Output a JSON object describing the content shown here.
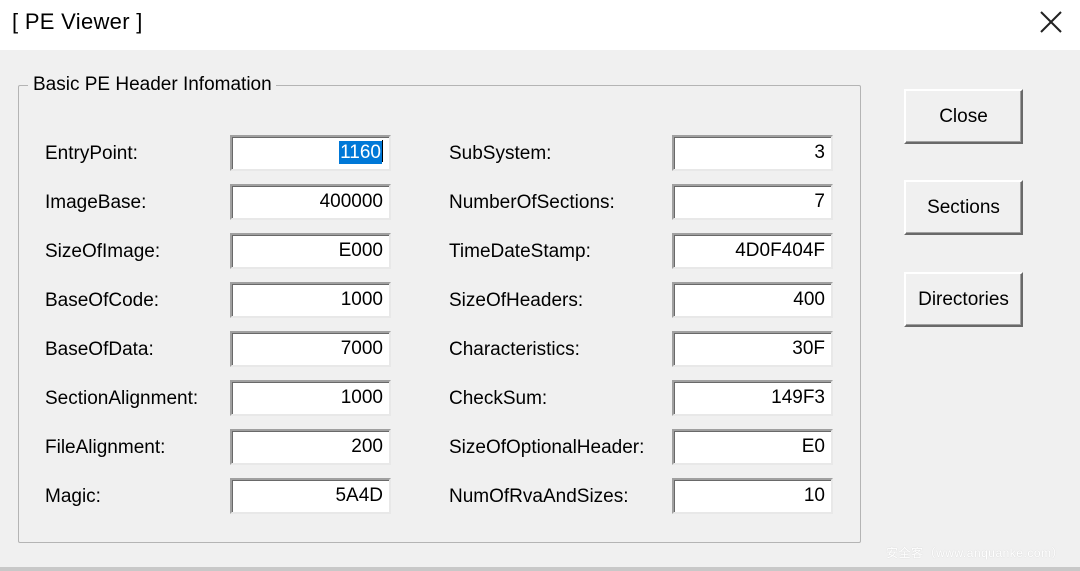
{
  "window": {
    "title": "[ PE Viewer ]",
    "close_icon": "close-icon"
  },
  "group": {
    "legend": "Basic PE Header Infomation"
  },
  "left_fields": [
    {
      "label": "EntryPoint:",
      "value": "1160"
    },
    {
      "label": "ImageBase:",
      "value": "400000"
    },
    {
      "label": "SizeOfImage:",
      "value": "E000"
    },
    {
      "label": "BaseOfCode:",
      "value": "1000"
    },
    {
      "label": "BaseOfData:",
      "value": "7000"
    },
    {
      "label": "SectionAlignment:",
      "value": "1000"
    },
    {
      "label": "FileAlignment:",
      "value": "200"
    },
    {
      "label": "Magic:",
      "value": "5A4D"
    }
  ],
  "right_fields": [
    {
      "label": "SubSystem:",
      "value": "3"
    },
    {
      "label": "NumberOfSections:",
      "value": "7"
    },
    {
      "label": "TimeDateStamp:",
      "value": "4D0F404F"
    },
    {
      "label": "SizeOfHeaders:",
      "value": "400"
    },
    {
      "label": "Characteristics:",
      "value": "30F"
    },
    {
      "label": "CheckSum:",
      "value": "149F3"
    },
    {
      "label": "SizeOfOptionalHeader:",
      "value": "E0"
    },
    {
      "label": "NumOfRvaAndSizes:",
      "value": "10"
    }
  ],
  "buttons": {
    "close": "Close",
    "sections": "Sections",
    "directories": "Directories"
  },
  "colors": {
    "selection": "#0078d7",
    "dialog_bg": "#f0f0f0",
    "titlebar_bg": "#ffffff"
  },
  "watermark": "安全客（www.anquanke.com）"
}
